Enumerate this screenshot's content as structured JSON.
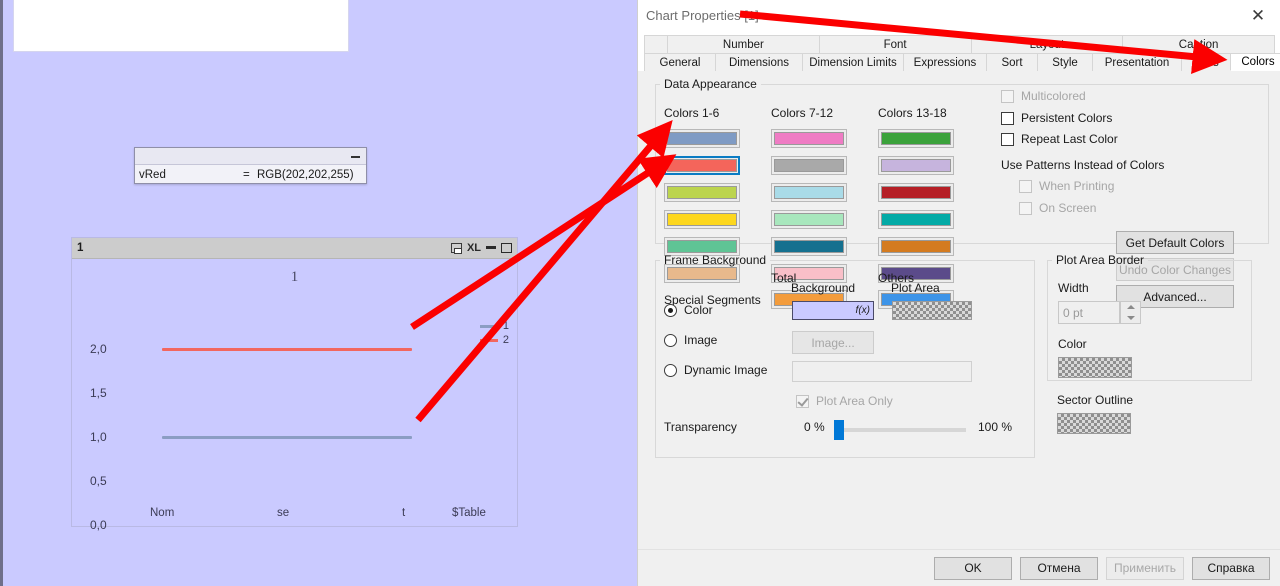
{
  "background_doc": {
    "variable_box": {
      "name": "vRed",
      "equals": "=",
      "value": "RGB(202,202,255)",
      "minimize_icon": "minimize-icon"
    },
    "chart_object": {
      "caption": "1",
      "icons": [
        "print-icon",
        "XL",
        "minimize-icon",
        "maximize-icon"
      ],
      "xl_label": "XL"
    }
  },
  "chart_data": {
    "type": "line",
    "title": "1",
    "categories": [
      "Nom",
      "se",
      "t",
      "$Table"
    ],
    "series": [
      {
        "name": "1",
        "values": [
          1,
          1,
          1
        ],
        "color": "#8b9dc3"
      },
      {
        "name": "2",
        "values": [
          2,
          2,
          2
        ],
        "color": "#f2675f"
      }
    ],
    "ytick_labels": [
      "2,0",
      "1,5",
      "1,0",
      "0,5",
      "0,0"
    ],
    "ylim": [
      0,
      2.25
    ],
    "xlabel": "",
    "ylabel": "",
    "grid": false,
    "legend_position": "right"
  },
  "dialog": {
    "title": "Chart Properties [1]",
    "close_icon": "close-icon",
    "tabs_row1": [
      "Number",
      "Font",
      "Layout",
      "Caption"
    ],
    "tabs_row2": [
      "General",
      "Dimensions",
      "Dimension Limits",
      "Expressions",
      "Sort",
      "Style",
      "Presentation",
      "Axes",
      "Colors"
    ],
    "active_tab": "Colors",
    "data_appearance": {
      "legend": "Data Appearance",
      "col1_label": "Colors 1-6",
      "col2_label": "Colors 7-12",
      "col3_label": "Colors 13-18",
      "col1_colors": [
        "#7f9bc4",
        "#f4655b",
        "#bcd44e",
        "#fdd71e",
        "#5fc495",
        "#e8b98c"
      ],
      "col2_colors": [
        "#ef7cc4",
        "#a9a9a9",
        "#a9dbe8",
        "#a8e7bd",
        "#15708f",
        "#f9bfc8"
      ],
      "col3_colors": [
        "#3ba23b",
        "#c6b4dd",
        "#b51f26",
        "#03aaa6",
        "#d47b20",
        "#5b4b8a"
      ],
      "selected_index": 1,
      "special_segments_label": "Special Segments",
      "total_label": "Total",
      "total_color": "#f39c3c",
      "others_label": "Others",
      "others_color": "#3d94e8"
    },
    "options": {
      "multicolored": {
        "label": "Multicolored",
        "checked": false,
        "enabled": false
      },
      "persistent_colors": {
        "label": "Persistent Colors",
        "checked": false,
        "enabled": true
      },
      "repeat_last_color": {
        "label": "Repeat Last Color",
        "checked": false,
        "enabled": true
      },
      "patterns_heading": "Use Patterns Instead of Colors",
      "when_printing": {
        "label": "When Printing",
        "checked": false,
        "enabled": false
      },
      "on_screen": {
        "label": "On Screen",
        "checked": false,
        "enabled": false
      },
      "get_default_colors": {
        "label": "Get Default Colors",
        "enabled": true
      },
      "undo_color_changes": {
        "label": "Undo Color Changes",
        "enabled": false
      },
      "advanced": {
        "label": "Advanced...",
        "enabled": true
      }
    },
    "frame_background": {
      "legend": "Frame Background",
      "background_label": "Background",
      "plot_area_label": "Plot Area",
      "color_radio": {
        "label": "Color",
        "selected": true
      },
      "image_radio": {
        "label": "Image",
        "selected": false
      },
      "dynamic_image_radio": {
        "label": "Dynamic Image",
        "selected": false
      },
      "background_swatch_color": "#cacaff",
      "background_fx": "f(x)",
      "image_button": "Image...",
      "dynamic_image_value": "",
      "plot_area_only": {
        "label": "Plot Area Only",
        "checked": true,
        "enabled": false
      },
      "transparency_label": "Transparency",
      "transparency_min": "0 %",
      "transparency_max": "100 %",
      "transparency_value": 3
    },
    "plot_area_border": {
      "legend": "Plot Area Border",
      "width_label": "Width",
      "width_value": "0 pt",
      "color_label": "Color"
    },
    "sector_outline": {
      "label": "Sector Outline"
    },
    "footer_buttons": [
      {
        "label": "OK",
        "enabled": true
      },
      {
        "label": "Отмена",
        "enabled": true
      },
      {
        "label": "Применить",
        "enabled": false
      },
      {
        "label": "Справка",
        "enabled": true
      }
    ]
  },
  "annotation": {
    "arrow_color": "#fb0000"
  }
}
